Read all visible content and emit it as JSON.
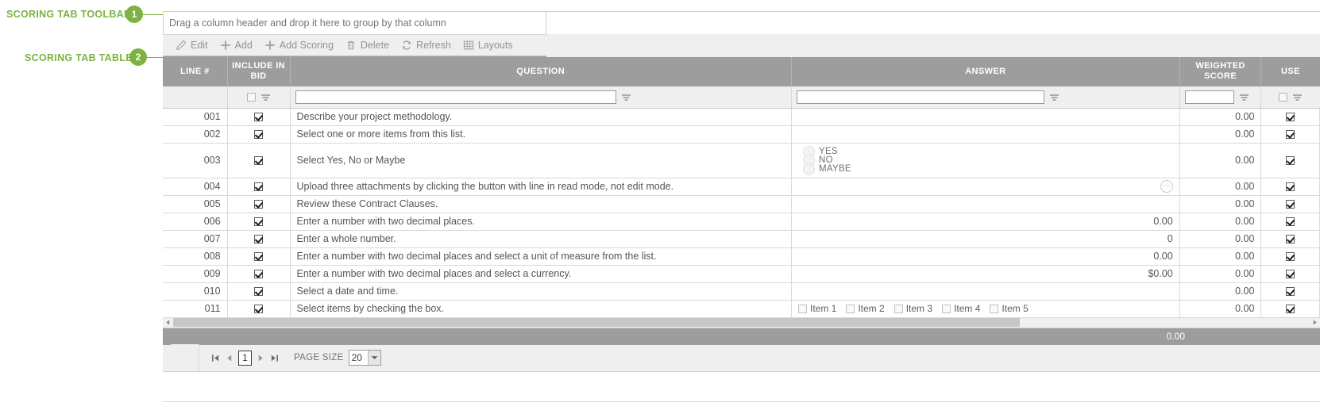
{
  "annotations": [
    {
      "label": "SCORING TAB TOOLBAR",
      "number": "1"
    },
    {
      "label": "SCORING TAB TABLE",
      "number": "2"
    }
  ],
  "accent_color": "#7cb342",
  "grid": {
    "group_bar_text": "Drag a column header and drop it here to group by that column",
    "toolbar": {
      "buttons": [
        {
          "label": "Edit",
          "icon": "pencil-icon"
        },
        {
          "label": "Add",
          "icon": "plus-icon"
        },
        {
          "label": "Add Scoring",
          "icon": "plus-icon"
        },
        {
          "label": "Delete",
          "icon": "trash-icon"
        },
        {
          "label": "Refresh",
          "icon": "refresh-icon"
        },
        {
          "label": "Layouts",
          "icon": "grid-icon"
        }
      ]
    },
    "columns": [
      {
        "key": "line",
        "label": "LINE #"
      },
      {
        "key": "include",
        "label": "INCLUDE IN BID"
      },
      {
        "key": "question",
        "label": "QUESTION"
      },
      {
        "key": "answer",
        "label": "ANSWER"
      },
      {
        "key": "weighted",
        "label": "WEIGHTED SCORE"
      },
      {
        "key": "use",
        "label": "USE"
      }
    ],
    "filter_row": {
      "question_value": "",
      "answer_value": "",
      "weighted_value": "",
      "include_checked": false,
      "use_checked": false
    },
    "rows": [
      {
        "line": "001",
        "include": true,
        "question": "Describe your project methodology.",
        "answer_type": "empty",
        "answer": "",
        "weighted": "0.00",
        "use": true
      },
      {
        "line": "002",
        "include": true,
        "question": "Select one or more items from this list.",
        "answer_type": "empty",
        "answer": "",
        "weighted": "0.00",
        "use": true
      },
      {
        "line": "003",
        "include": true,
        "question": "Select Yes, No or Maybe",
        "answer_type": "radios",
        "answer_options": [
          "YES",
          "NO",
          "MAYBE"
        ],
        "answer": "",
        "weighted": "0.00",
        "use": true
      },
      {
        "line": "004",
        "include": true,
        "question": "Upload three attachments by clicking the button with line in read mode, not edit mode.",
        "answer_type": "ellipsis",
        "answer": "⋯",
        "weighted": "0.00",
        "use": true
      },
      {
        "line": "005",
        "include": true,
        "question": "Review these Contract Clauses.",
        "answer_type": "empty",
        "answer": "",
        "weighted": "0.00",
        "use": true
      },
      {
        "line": "006",
        "include": true,
        "question": "Enter a number with two decimal places.",
        "answer_type": "value",
        "answer": "0.00",
        "weighted": "0.00",
        "use": true
      },
      {
        "line": "007",
        "include": true,
        "question": "Enter a whole number.",
        "answer_type": "value",
        "answer": "0",
        "weighted": "0.00",
        "use": true
      },
      {
        "line": "008",
        "include": true,
        "question": "Enter a number with two decimal places and select a unit of measure from the list.",
        "answer_type": "value",
        "answer": "0.00",
        "weighted": "0.00",
        "use": true
      },
      {
        "line": "009",
        "include": true,
        "question": "Enter a number with two decimal places and select a currency.",
        "answer_type": "value",
        "answer": "$0.00",
        "weighted": "0.00",
        "use": true
      },
      {
        "line": "010",
        "include": true,
        "question": "Select a date and time.",
        "answer_type": "empty",
        "answer": "",
        "weighted": "0.00",
        "use": true
      },
      {
        "line": "011",
        "include": true,
        "question": "Select items by checking the box.",
        "answer_type": "checkboxes",
        "answer_options": [
          "Item 1",
          "Item 2",
          "Item 3",
          "Item 4",
          "Item 5"
        ],
        "answer": "",
        "weighted": "0.00",
        "use": true
      }
    ],
    "totals": {
      "weighted_total": "0.00"
    },
    "pager": {
      "current_page": "1",
      "page_size_label": "PAGE SIZE",
      "page_size_value": "20"
    }
  }
}
